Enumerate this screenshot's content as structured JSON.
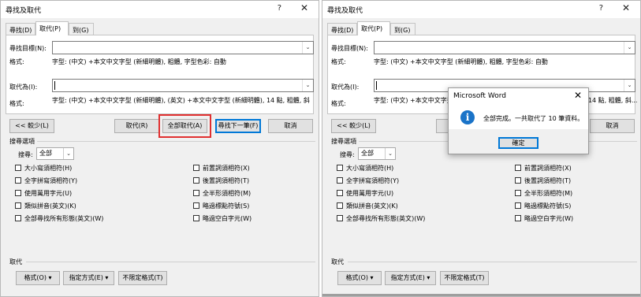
{
  "dialog": {
    "title": "尋找及取代",
    "help_glyph": "?",
    "close_glyph": "✕",
    "tabs": [
      "尋找(D)",
      "取代(P)",
      "到(G)"
    ],
    "find_label": "尋找目標(N):",
    "find_value": "",
    "find_format_label": "格式:",
    "find_format_value": "字型: (中文) +本文中文字型 (新細明體), 粗體, 字型色彩: 自動",
    "replace_label": "取代為(I):",
    "replace_value": "",
    "replace_format_label": "格式:",
    "replace_format_value_left": "字型: (中文) +本文中文字型 (新細明體), (英文) +本文中文字型 (新細明體), 14 點, 粗體, 斜",
    "replace_format_value_right": "字型: (中文) +本文中文字型 (新細明體), (英文) +本文中文字型 (新細明體), 14 點, 粗體, 斜...",
    "less_button": "<< 較少(L)",
    "replace_button": "取代(R)",
    "replace_all_button": "全部取代(A)",
    "find_next_button": "尋找下一筆(F)",
    "cancel_button": "取消",
    "search_options_title": "搜尋選項",
    "search_label": "搜尋:",
    "search_value": "全部",
    "options_left": [
      "大小寫須相符(H)",
      "全字拼寫須相符(Y)",
      "使用萬用字元(U)",
      "類似拼音(英文)(K)",
      "全部尋找所有形態(英文)(W)"
    ],
    "options_right": [
      "前置詞須相符(X)",
      "後置詞須相符(T)",
      "全半形須相符(M)",
      "略過標點符號(S)",
      "略過空白字元(W)"
    ],
    "replace_section_title": "取代",
    "format_button": "格式(O) ▾",
    "special_button": "指定方式(E) ▾",
    "no_format_button": "不限定格式(T)",
    "dropdown_glyph": "⌄"
  },
  "message_box": {
    "title": "Microsoft Word",
    "close_glyph": "✕",
    "icon": "information-icon",
    "icon_glyph": "i",
    "text": "全部完成。一共取代了 10 筆資料。",
    "ok_button": "確定"
  },
  "colors": {
    "highlight_box": "#e03030",
    "default_button_border": "#0078d7",
    "info_icon": "#1a73c8"
  }
}
